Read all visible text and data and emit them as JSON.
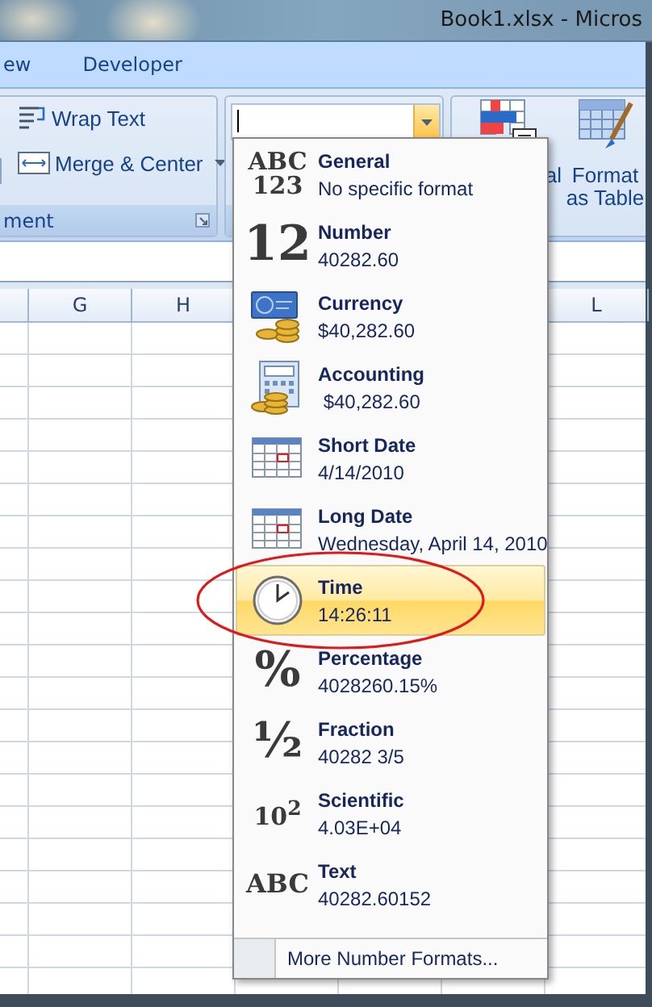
{
  "window": {
    "title": "Book1.xlsx - Micros"
  },
  "ribbon_tabs": [
    {
      "label": "ew",
      "selected": false
    },
    {
      "label": "Developer",
      "selected": false
    }
  ],
  "alignment_group": {
    "label": "ment",
    "buttons": [
      {
        "label": "Wrap Text",
        "dropdown": false
      },
      {
        "label": "Merge & Center",
        "dropdown": true
      }
    ]
  },
  "styles_group": {
    "buttons": [
      {
        "label": "al"
      },
      {
        "label": "Format as Table"
      }
    ]
  },
  "columns": [
    "G",
    "H",
    "L"
  ],
  "format_menu": {
    "items": [
      {
        "label": "General",
        "sample": "No specific format",
        "selected": false,
        "icon": {
          "kind": "glyph",
          "text": "ABC 123"
        }
      },
      {
        "label": "Number",
        "sample": "40282.60",
        "selected": false,
        "icon": {
          "kind": "glyph",
          "text": "12"
        }
      },
      {
        "label": "Currency",
        "sample": "$40,282.60",
        "selected": false,
        "icon": {
          "kind": "currency"
        }
      },
      {
        "label": "Accounting",
        "sample": " $40,282.60",
        "selected": false,
        "icon": {
          "kind": "accounting"
        }
      },
      {
        "label": "Short Date",
        "sample": "4/14/2010",
        "selected": false,
        "icon": {
          "kind": "calendar"
        }
      },
      {
        "label": "Long Date",
        "sample": "Wednesday, April 14, 2010",
        "selected": false,
        "icon": {
          "kind": "calendar"
        }
      },
      {
        "label": "Time",
        "sample": "14:26:11",
        "selected": true,
        "icon": {
          "kind": "clock"
        }
      },
      {
        "label": "Percentage",
        "sample": "4028260.15%",
        "selected": false,
        "icon": {
          "kind": "glyph",
          "text": "%"
        }
      },
      {
        "label": "Fraction",
        "sample": "40282 3/5",
        "selected": false,
        "icon": {
          "kind": "glyph",
          "text": "½"
        }
      },
      {
        "label": "Scientific",
        "sample": "4.03E+04",
        "selected": false,
        "icon": {
          "kind": "glyph",
          "text": "10$^{2}$"
        }
      },
      {
        "label": "Text",
        "sample": "40282.60152",
        "selected": false,
        "icon": {
          "kind": "glyph",
          "text": "ABC"
        }
      }
    ],
    "footer": "More Number Formats...",
    "annotation_ring": true
  }
}
